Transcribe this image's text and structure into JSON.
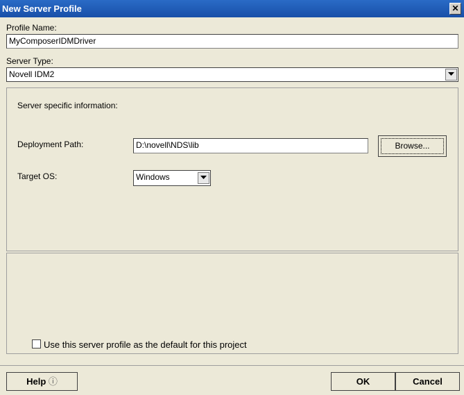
{
  "window": {
    "title": "New Server Profile",
    "close_glyph": "✕"
  },
  "profile_name": {
    "label": "Profile Name:",
    "value": "MyComposerIDMDriver"
  },
  "server_type": {
    "label": "Server Type:",
    "value": "Novell IDM2"
  },
  "server_specific": {
    "heading": "Server specific information:",
    "deployment_path": {
      "label": "Deployment Path:",
      "value": "D:\\novell\\NDS\\lib"
    },
    "browse_label": "Browse...",
    "target_os": {
      "label": "Target OS:",
      "value": "Windows"
    }
  },
  "default_checkbox": {
    "label": "Use this server profile as the default for this project",
    "checked": false
  },
  "buttons": {
    "help": "Help",
    "help_icon": "ⓘ",
    "ok": "OK",
    "cancel": "Cancel"
  }
}
